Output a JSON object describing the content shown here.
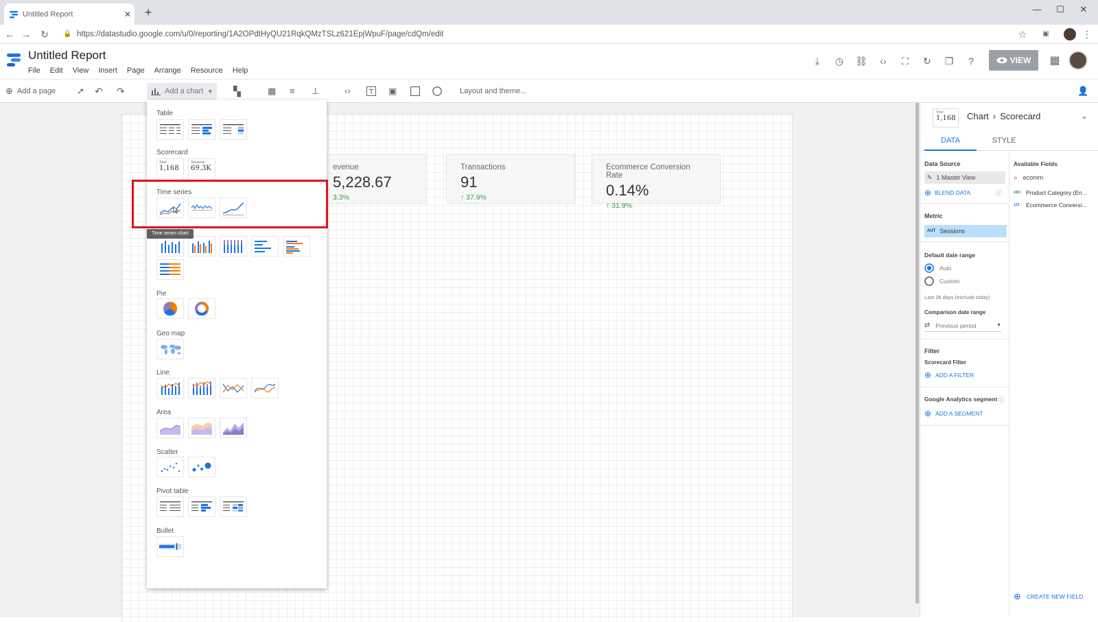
{
  "browser": {
    "tab_title": "Untitled Report",
    "url": "https://datastudio.google.com/u/0/reporting/1A2OPdtHyQU21RqkQMzTSLz621EpjWpuF/page/cdQm/edit"
  },
  "app": {
    "report_title": "Untitled Report",
    "menu": [
      "File",
      "Edit",
      "View",
      "Insert",
      "Page",
      "Arrange",
      "Resource",
      "Help"
    ],
    "view_label": "VIEW"
  },
  "toolbar": {
    "add_page": "Add a page",
    "add_chart": "Add a chart",
    "layout_theme": "Layout and theme..."
  },
  "scorecards": [
    {
      "label": "evenue",
      "value": "5,228.67",
      "change": "3.3%"
    },
    {
      "label": "Transactions",
      "value": "91",
      "change": "↑ 37.9%"
    },
    {
      "label": "Ecommerce Conversion Rate",
      "value": "0.14%",
      "change": "↑ 31.9%"
    }
  ],
  "chart_menu": {
    "categories": [
      "Table",
      "Scorecard",
      "Time series",
      "Pie",
      "Geo map",
      "Line",
      "Area",
      "Scatter",
      "Pivot table",
      "Bullet"
    ],
    "scorecard_thumbs": [
      {
        "label": "Total",
        "value": "1,168"
      },
      {
        "label": "Sessions",
        "value": "69.3K"
      }
    ],
    "tooltip": "Time series chart"
  },
  "panel": {
    "preview_label": "Total",
    "preview_value": "1,168",
    "breadcrumb_chart": "Chart",
    "breadcrumb_type": "Scorecard",
    "tab_data": "DATA",
    "tab_style": "STYLE",
    "data_source_label": "Data Source",
    "data_source_value": "1 Master View",
    "blend_data": "BLEND DATA",
    "metric_label": "Metric",
    "metric_tag": "AUT",
    "metric_value": "Sessions",
    "default_date_label": "Default date range",
    "date_auto": "Auto",
    "date_custom": "Custom",
    "date_note": "Last 28 days (exclude today)",
    "comparison_label": "Comparison date range",
    "comparison_value": "Previous period",
    "filter_label": "Filter",
    "scorecard_filter": "Scorecard Filter",
    "add_filter": "ADD A FILTER",
    "ga_segment_label": "Google Analytics segment",
    "add_segment": "ADD A SEGMENT",
    "available_fields_label": "Available Fields",
    "search_value": "ecomm",
    "fields": [
      {
        "tag": "ABC",
        "name": "Product Category (En..."
      },
      {
        "tag": "123",
        "name": "Ecommerce Conversi..."
      }
    ],
    "create_field": "CREATE NEW FIELD"
  },
  "colors": {
    "accent": "#1a73e8",
    "highlight": "#e0101a",
    "positive": "#2e9b45",
    "orange": "#f57c00",
    "purple": "#8e7cc3"
  }
}
